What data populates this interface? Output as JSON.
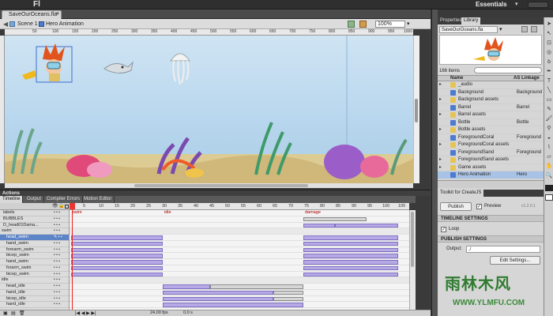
{
  "app": {
    "logo": "Fl",
    "workspace": "Essentials"
  },
  "document": {
    "tab": "SaveOurOceans.fla*"
  },
  "editbar": {
    "scene": "Scene 1",
    "symbol": "Hero Animation",
    "zoom": "100%"
  },
  "ruler_marks": [
    "50",
    "100",
    "150",
    "200",
    "250",
    "300",
    "350",
    "400",
    "450",
    "500",
    "550",
    "600",
    "650",
    "700",
    "750",
    "800",
    "850",
    "900",
    "950",
    "1000"
  ],
  "panel": {
    "tabs": [
      "Properties",
      "Library"
    ],
    "library_file": "SaveOurOceans.fla",
    "item_count": "166 items",
    "col_name": "Name",
    "col_linkage": "AS Linkage",
    "items": [
      {
        "name": "_audio",
        "linkage": "",
        "kind": "folder"
      },
      {
        "name": "Background",
        "linkage": "Background",
        "kind": "symbol"
      },
      {
        "name": "Background assets",
        "linkage": "",
        "kind": "folder"
      },
      {
        "name": "Barrel",
        "linkage": "Barrel",
        "kind": "symbol"
      },
      {
        "name": "Barrel assets",
        "linkage": "",
        "kind": "folder"
      },
      {
        "name": "Bottle",
        "linkage": "Bottle",
        "kind": "symbol"
      },
      {
        "name": "Bottle assets",
        "linkage": "",
        "kind": "folder"
      },
      {
        "name": "ForegroundCoral",
        "linkage": "Foreground",
        "kind": "symbol"
      },
      {
        "name": "ForegroundCoral assets",
        "linkage": "",
        "kind": "folder"
      },
      {
        "name": "ForegroundSand",
        "linkage": "Foreground",
        "kind": "symbol"
      },
      {
        "name": "ForegroundSand assets",
        "linkage": "",
        "kind": "folder"
      },
      {
        "name": "Game assets",
        "linkage": "",
        "kind": "folder"
      },
      {
        "name": "Hero Animation",
        "linkage": "Hero",
        "kind": "symbol"
      }
    ]
  },
  "toolkit": {
    "tab": "Toolkit for CreateJS",
    "publish": "Publish",
    "preview": "Preview",
    "version": "v1.2.0.1",
    "timeline_settings": "TIMELINE SETTINGS",
    "loop": "Loop",
    "publish_settings": "PUBLISH SETTINGS",
    "output_label": "Output:",
    "output_value": "./",
    "edit_settings": "Edit Settings..."
  },
  "timeline": {
    "panel_title": "Actions",
    "tabs": [
      "Timeline",
      "Output",
      "Compiler Errors",
      "Motion Editor"
    ],
    "frame_numbers": [
      "1",
      "5",
      "10",
      "15",
      "20",
      "25",
      "30",
      "35",
      "40",
      "45",
      "50",
      "55",
      "60",
      "65",
      "70",
      "75",
      "80",
      "85",
      "90",
      "95",
      "100",
      "105"
    ],
    "frame_labels": [
      "swim",
      "idle",
      "damage"
    ],
    "layers": [
      {
        "name": "labels",
        "indent": 0
      },
      {
        "name": "BUBBLES",
        "indent": 0
      },
      {
        "name": "D_head01Dama...",
        "indent": 0
      },
      {
        "name": "swim",
        "indent": 0
      },
      {
        "name": "head_swim",
        "indent": 1
      },
      {
        "name": "hand_swim",
        "indent": 1
      },
      {
        "name": "forearm_swim",
        "indent": 1
      },
      {
        "name": "bicep_swim",
        "indent": 1
      },
      {
        "name": "hand_swim",
        "indent": 1
      },
      {
        "name": "forarm_swim",
        "indent": 1
      },
      {
        "name": "bicep_swim",
        "indent": 1
      },
      {
        "name": "idle",
        "indent": 0
      },
      {
        "name": "head_idle",
        "indent": 1
      },
      {
        "name": "hand_idle",
        "indent": 1
      },
      {
        "name": "bicep_idle",
        "indent": 1
      },
      {
        "name": "hand_idle",
        "indent": 1
      }
    ],
    "fps": "24.00 fps",
    "time": "0.0 s"
  },
  "watermark": {
    "text": "雨林木风",
    "url": "WWW.YLMFU.COM"
  },
  "colors": {
    "accent": "#5e84c8",
    "tween": "#b6a9e5",
    "playhead": "#e22222"
  }
}
